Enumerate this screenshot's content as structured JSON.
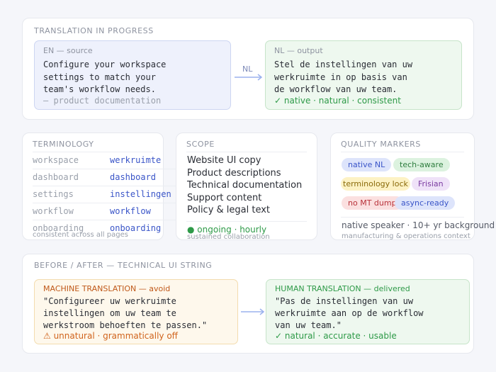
{
  "translation": {
    "label": "TRANSLATION IN PROGRESS",
    "source": {
      "header": "EN — source",
      "lines": [
        "Configure your workspace",
        "settings to match your",
        "team's workflow needs."
      ],
      "note": "— product documentation"
    },
    "arrow_label": "NL",
    "output": {
      "header": "NL — output",
      "lines": [
        "Stel de instellingen van uw",
        "werkruimte in op basis van",
        "de workflow van uw team."
      ],
      "note": "✓ native · natural · consistent"
    }
  },
  "terminology": {
    "label": "TERMINOLOGY",
    "rows": [
      {
        "en": "workspace",
        "nl": "werkruimte"
      },
      {
        "en": "dashboard",
        "nl": "dashboard"
      },
      {
        "en": "settings",
        "nl": "instellingen"
      },
      {
        "en": "workflow",
        "nl": "workflow"
      },
      {
        "en": "onboarding",
        "nl": "onboarding"
      }
    ],
    "footer": "consistent across all pages"
  },
  "scope": {
    "label": "SCOPE",
    "items": [
      "Website UI copy",
      "Product descriptions",
      "Technical documentation",
      "Support content",
      "Policy & legal text"
    ],
    "status": "● ongoing · hourly",
    "status_sub": "sustained collaboration"
  },
  "quality": {
    "label": "QUALITY MARKERS",
    "pills": [
      {
        "text": "native NL",
        "bg": "#dde4fb",
        "fg": "#3a55c8"
      },
      {
        "text": "tech-aware",
        "bg": "#dcf2df",
        "fg": "#2e7d3e"
      },
      {
        "text": "terminology lock",
        "bg": "#fdf2c4",
        "fg": "#8a6a0a"
      },
      {
        "text": "Frisian",
        "bg": "#efe2f8",
        "fg": "#7a3aa0"
      },
      {
        "text": "no MT dump",
        "bg": "#fbe0e0",
        "fg": "#b8323a"
      },
      {
        "text": "async-ready",
        "bg": "#dde4fb",
        "fg": "#3a55c8"
      }
    ],
    "main": "native speaker · 10+ yr background",
    "sub": "manufacturing & operations context"
  },
  "comparison": {
    "label": "BEFORE / AFTER — TECHNICAL UI STRING",
    "machine": {
      "header": "MACHINE TRANSLATION — avoid",
      "lines": [
        "\"Configureer uw werkruimte",
        "instellingen om uw team te",
        "werkstroom behoeften te passen.\""
      ],
      "note": "⚠ unnatural · grammatically off"
    },
    "human": {
      "header": "HUMAN TRANSLATION — delivered",
      "lines": [
        "\"Pas de instellingen van uw",
        "werkruimte aan op de workflow",
        "van uw team.\""
      ],
      "note": "✓ natural · accurate · usable"
    }
  },
  "colors": {
    "accent_blue": "#3a55c8",
    "success_green": "#2e9a48",
    "warning_orange": "#d0641d",
    "arrow": "#9bb2ee"
  }
}
